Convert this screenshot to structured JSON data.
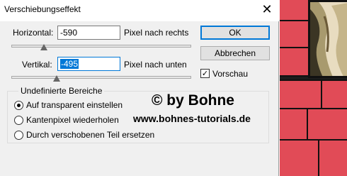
{
  "window": {
    "title": "Verschiebungseffekt",
    "close_glyph": "✕"
  },
  "horizontal": {
    "label": "Horizontal:",
    "value": "-590",
    "unit": "Pixel nach rechts",
    "slider_level": 0.18
  },
  "vertical": {
    "label": "Vertikal:",
    "value": "-495",
    "unit": "Pixel nach unten",
    "slider_level": 0.25
  },
  "buttons": {
    "ok": "OK",
    "cancel": "Abbrechen"
  },
  "preview": {
    "label": "Vorschau",
    "checked": true,
    "check_glyph": "✓"
  },
  "undefined_areas": {
    "title": "Undefinierte Bereiche",
    "options": [
      {
        "label": "Auf transparent einstellen",
        "selected": true
      },
      {
        "label": "Kantenpixel wiederholen",
        "selected": false
      },
      {
        "label": "Durch verschobenen Teil ersetzen",
        "selected": false
      }
    ]
  },
  "watermark": {
    "line1": "© by Bohne",
    "line2": "www.bohnes-tutorials.de"
  },
  "colors": {
    "accent": "#0078d7",
    "brick": "#e14b57",
    "mortar": "#111111"
  }
}
